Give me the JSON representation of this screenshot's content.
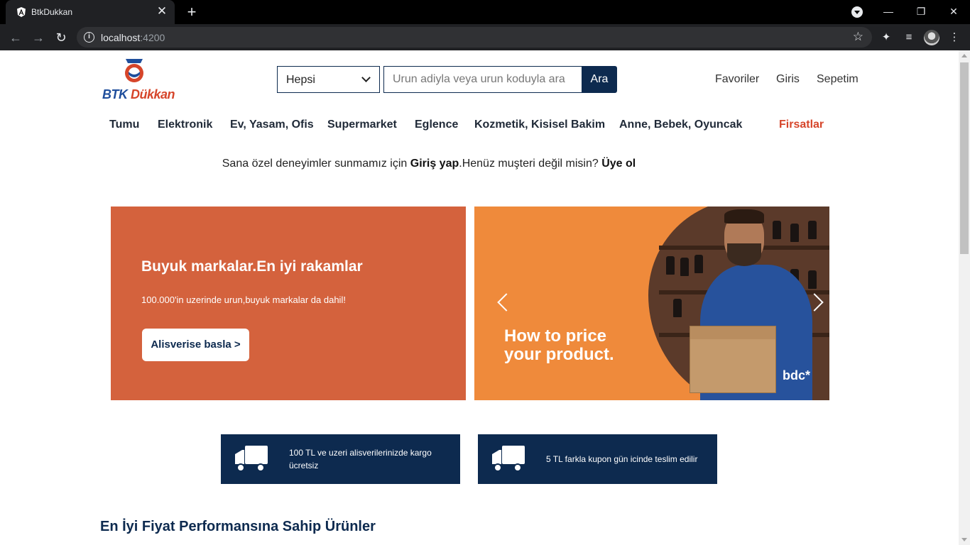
{
  "browser": {
    "tab_title": "BtkDukkan",
    "url_host": "localhost",
    "url_port": ":4200"
  },
  "header": {
    "logo_text_1": "BTK",
    "logo_text_2": "Dükkan",
    "category_select_value": "Hepsi",
    "search_placeholder": "Urun adiyla veya urun koduyla ara",
    "search_button": "Ara",
    "links": [
      "Favoriler",
      "Giris",
      "Sepetim"
    ]
  },
  "nav": {
    "categories": [
      "Tumu",
      "Elektronik",
      "Ev, Yasam, Ofis",
      "Supermarket",
      "Eglence",
      "Kozmetik, Kisisel Bakim",
      "Anne, Bebek, Oyuncak"
    ],
    "deals": "Firsatlar"
  },
  "login_banner": {
    "text_before": "Sana özel deneyimler sunmamız için ",
    "login_link": "Giriş yap",
    "text_middle": ".Henüz muşteri değil misin? ",
    "signup_link": "Üye ol"
  },
  "promo": {
    "heading": "Buyuk markalar.En iyi rakamlar",
    "subtext": "100.000'in uzerinde urun,buyuk markalar da dahil!",
    "button": "Alisverise basla >"
  },
  "carousel": {
    "caption_line1": "How to price",
    "caption_line2": "your product.",
    "brand": "bdc*"
  },
  "info_cards": [
    {
      "text": "100 TL ve uzeri alisverilerinizde kargo ücretsiz",
      "icon": "truck-icon"
    },
    {
      "text": "5 TL farkla kupon gün icinde teslim edilir",
      "icon": "truck-icon"
    }
  ],
  "section_title": "En İyi Fiyat Performansına Sahip Ürünler",
  "colors": {
    "navy": "#0d2a4f",
    "promo_orange": "#d4623d",
    "carousel_orange": "#ef8a3b",
    "deals_red": "#d6452a"
  }
}
